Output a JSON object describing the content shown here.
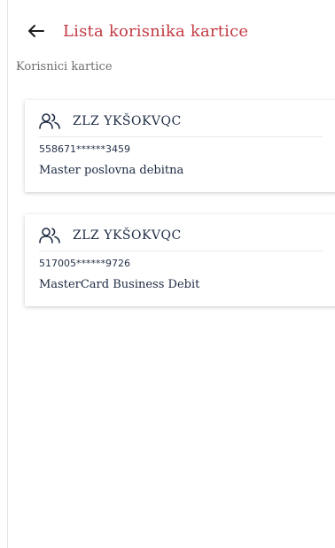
{
  "header": {
    "back_icon": "arrow-left-icon",
    "title": "Lista korisnika kartice"
  },
  "section": {
    "label": "Korisnici kartice"
  },
  "cards": [
    {
      "icon": "users-icon",
      "name": "ZLZ YKŠOKVQC",
      "number": "558671******3459",
      "type": "Master poslovna debitna"
    },
    {
      "icon": "users-icon",
      "name": "ZLZ YKŠOKVQC",
      "number": "517005******9726",
      "type": "MasterCard Business Debit"
    }
  ],
  "colors": {
    "title": "#c33a43",
    "text_dark": "#1d2b44",
    "label_gray": "#6e6e6e"
  }
}
